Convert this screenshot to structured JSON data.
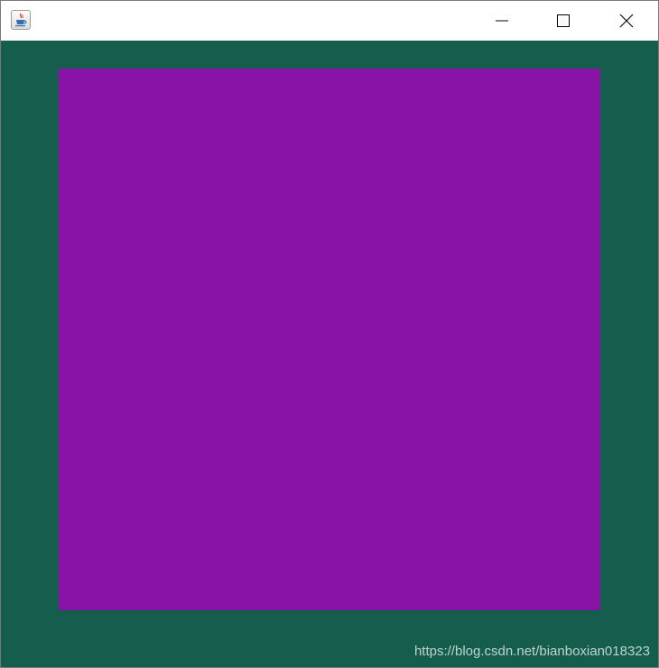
{
  "window": {
    "app_icon": "java-coffee-cup-icon",
    "controls": {
      "minimize_icon": "minimize-icon",
      "maximize_icon": "maximize-icon",
      "close_icon": "close-icon"
    }
  },
  "canvas": {
    "background_color": "#155e4d",
    "square_color": "#8813a6"
  },
  "watermark": {
    "text": "https://blog.csdn.net/bianboxian018323"
  }
}
